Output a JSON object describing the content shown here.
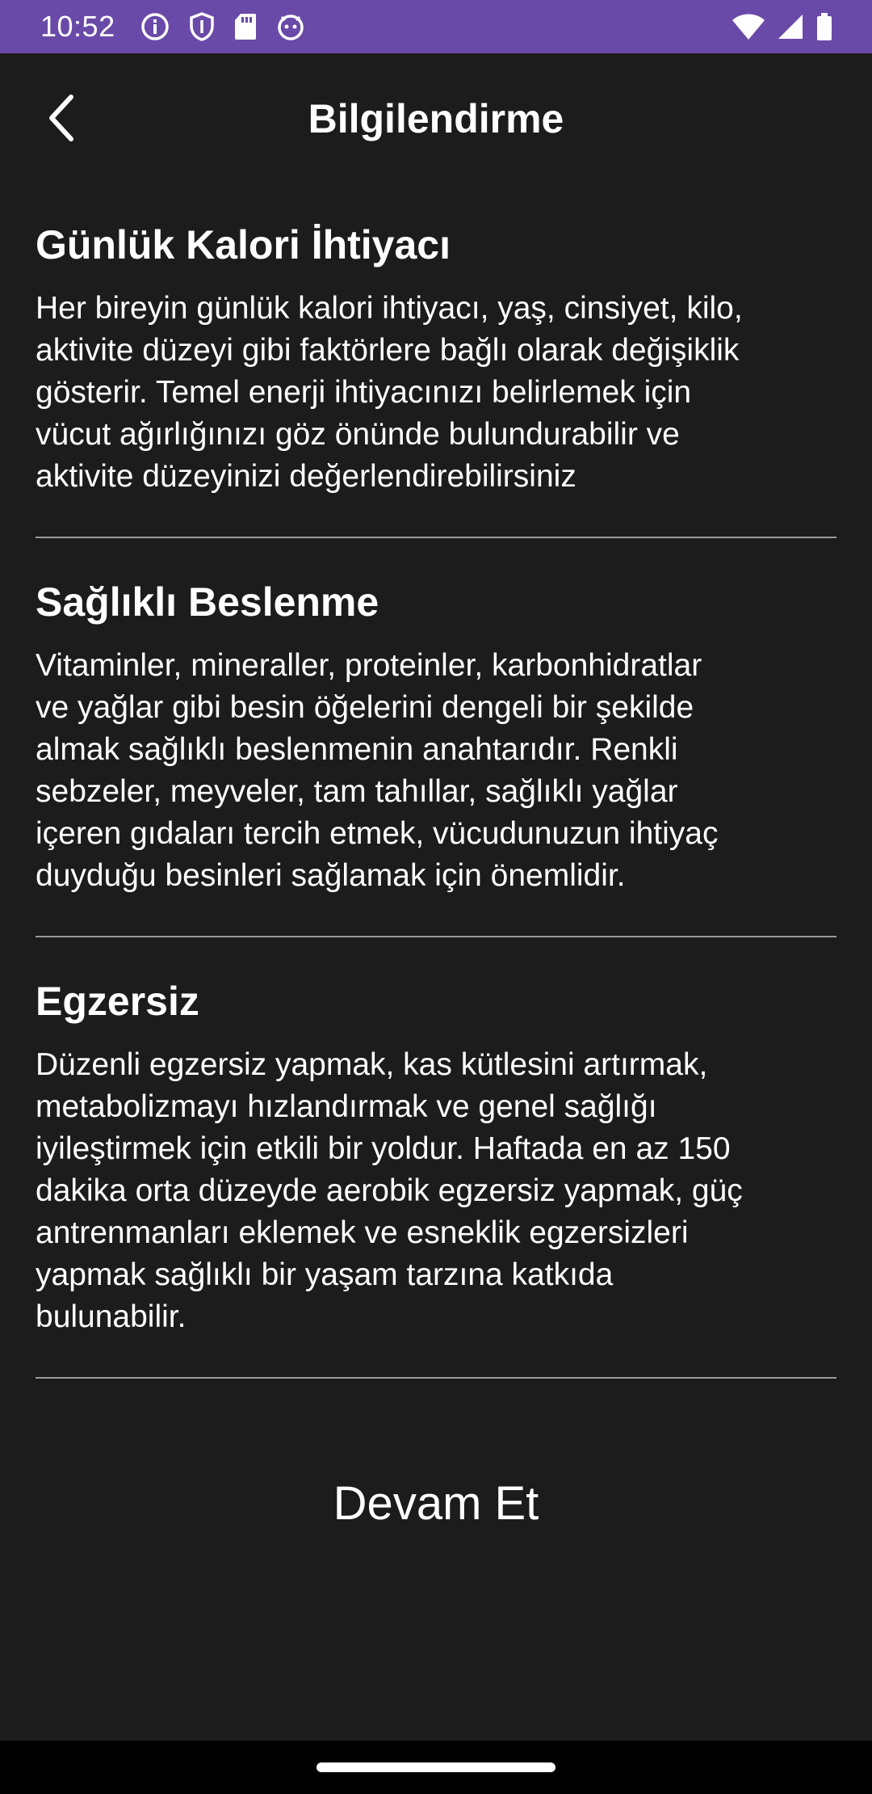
{
  "status_bar": {
    "time": "10:52",
    "left_icons": [
      "info-icon",
      "shield-icon",
      "sd-card-icon",
      "android-icon"
    ],
    "right_icons": [
      "wifi-icon",
      "signal-icon",
      "battery-icon"
    ],
    "background": "#6a4aa8"
  },
  "app_bar": {
    "title": "Bilgilendirme",
    "back_icon": "back-arrow-icon"
  },
  "sections": [
    {
      "title": "Günlük Kalori İhtiyacı",
      "lines": [
        "Her bireyin günlük kalori ihtiyacı, yaş, cinsiyet, kilo,",
        "aktivite düzeyi gibi faktörlere bağlı olarak değişiklik",
        "gösterir. Temel enerji ihtiyacınızı belirlemek için",
        "vücut ağırlığınızı göz önünde bulundurabilir ve",
        "aktivite düzeyinizi değerlendirebilirsiniz"
      ]
    },
    {
      "title": "Sağlıklı Beslenme",
      "lines": [
        "Vitaminler, mineraller, proteinler, karbonhidratlar",
        "ve yağlar gibi besin öğelerini dengeli bir şekilde",
        "almak sağlıklı beslenmenin anahtarıdır. Renkli",
        "sebzeler, meyveler, tam tahıllar, sağlıklı yağlar",
        "içeren gıdaları tercih etmek, vücudunuzun ihtiyaç",
        "duyduğu besinleri sağlamak için önemlidir."
      ]
    },
    {
      "title": "Egzersiz",
      "lines": [
        "Düzenli egzersiz yapmak, kas kütlesini artırmak,",
        "metabolizmayı hızlandırmak ve genel sağlığı",
        "iyileştirmek için etkili bir yoldur. Haftada en az 150",
        "dakika orta düzeyde aerobik egzersiz yapmak, güç",
        "antrenmanları eklemek ve esneklik egzersizleri",
        "yapmak sağlıklı bir yaşam tarzına katkıda",
        "bulunabilir."
      ]
    }
  ],
  "continue_button": {
    "label": "Devam Et"
  }
}
